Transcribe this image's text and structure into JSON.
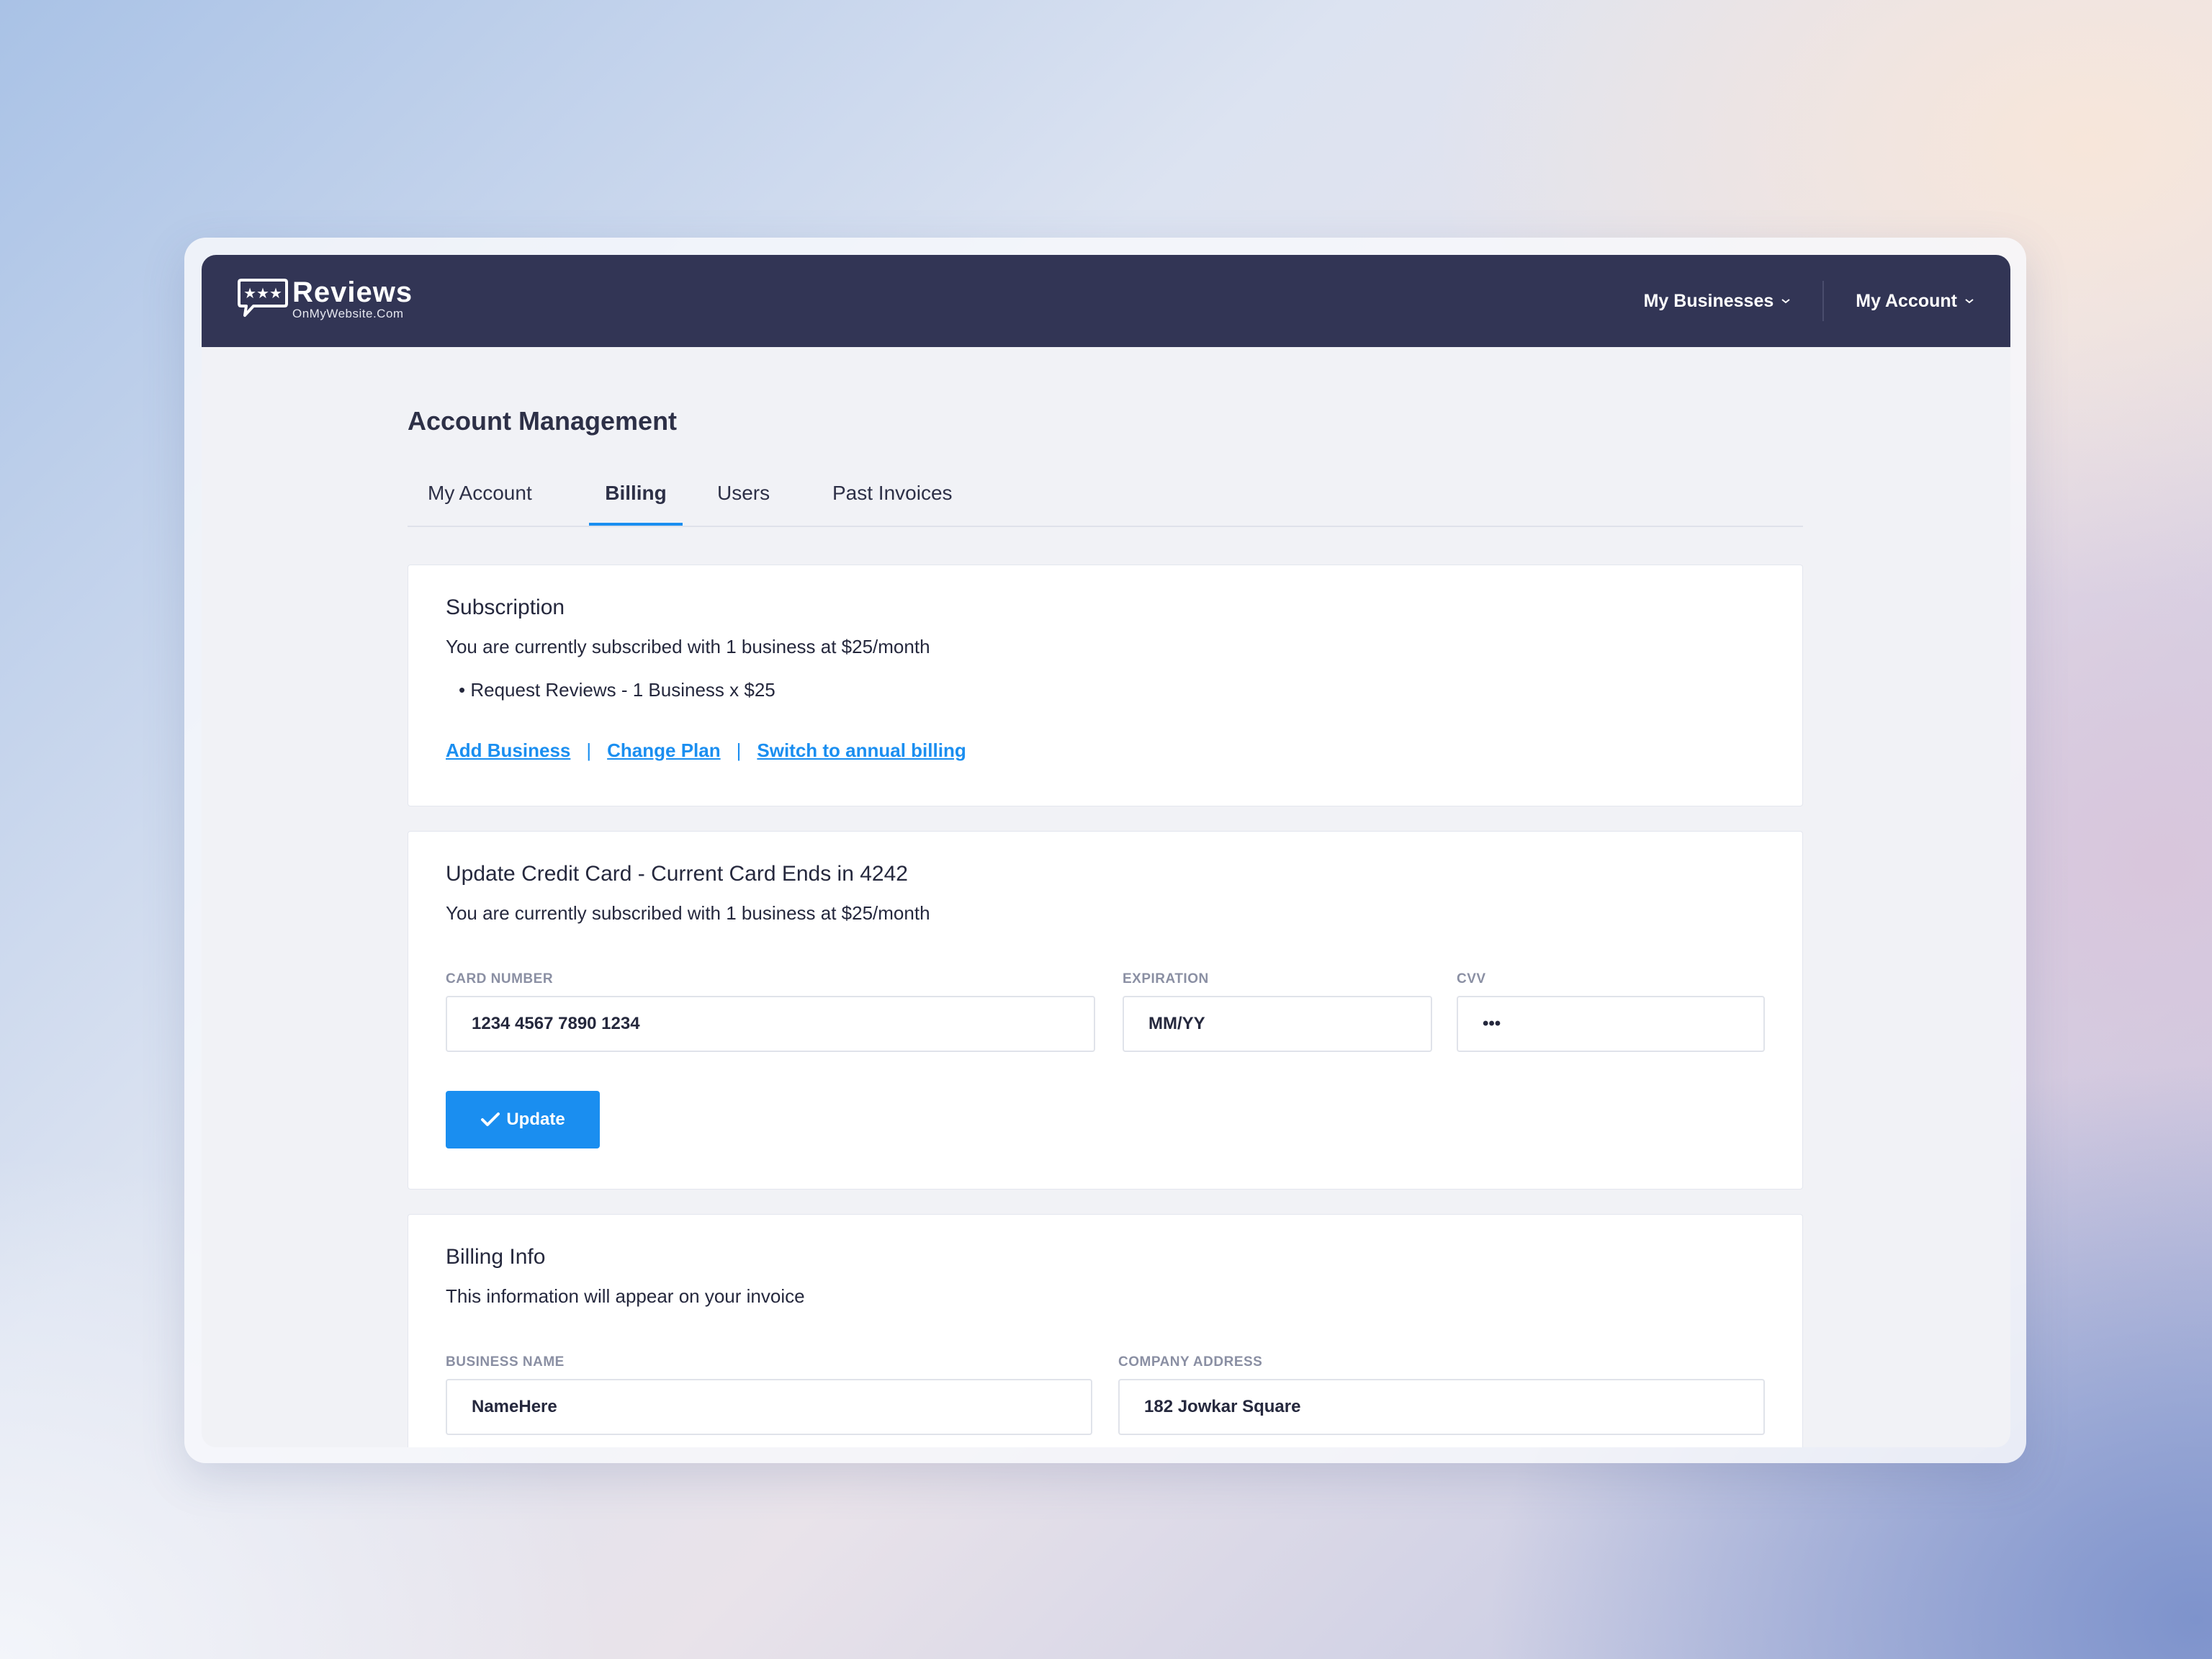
{
  "header": {
    "logo_title": "Reviews",
    "logo_subtitle": "OnMyWebsite.Com",
    "nav": [
      {
        "label": "My Businesses"
      },
      {
        "label": "My Account"
      }
    ]
  },
  "page": {
    "title": "Account Management",
    "tabs": [
      {
        "label": "My Account",
        "active": false
      },
      {
        "label": "Billing",
        "active": true
      },
      {
        "label": "Users",
        "active": false
      },
      {
        "label": "Past Invoices",
        "active": false
      }
    ]
  },
  "subscription": {
    "title": "Subscription",
    "description": "You are currently subscribed with 1 business at $25/month",
    "bullet": "• Request Reviews - 1 Business x $25",
    "links": {
      "add_business": "Add Business",
      "change_plan": "Change Plan",
      "switch_annual": "Switch to annual billing",
      "separator": "|"
    }
  },
  "credit_card": {
    "title": "Update Credit Card - Current Card Ends in 4242",
    "description": "You are currently subscribed with 1 business at $25/month",
    "card_number": {
      "label": "CARD NUMBER",
      "value": "1234 4567 7890 1234"
    },
    "expiration": {
      "label": "EXPIRATION",
      "placeholder": "MM/YY"
    },
    "cvv": {
      "label": "CVV",
      "value": "•••"
    },
    "update_button": "Update"
  },
  "billing_info": {
    "title": "Billing Info",
    "description": "This information will appear on your invoice",
    "business_name": {
      "label": "BUSINESS NAME",
      "value": "NameHere"
    },
    "company_address": {
      "label": "COMPANY ADDRESS",
      "value": "182 Jowkar Square"
    }
  },
  "colors": {
    "topbar": "#323555",
    "accent": "#1a8ef0",
    "background": "#f1f2f6",
    "text": "#25283d"
  }
}
